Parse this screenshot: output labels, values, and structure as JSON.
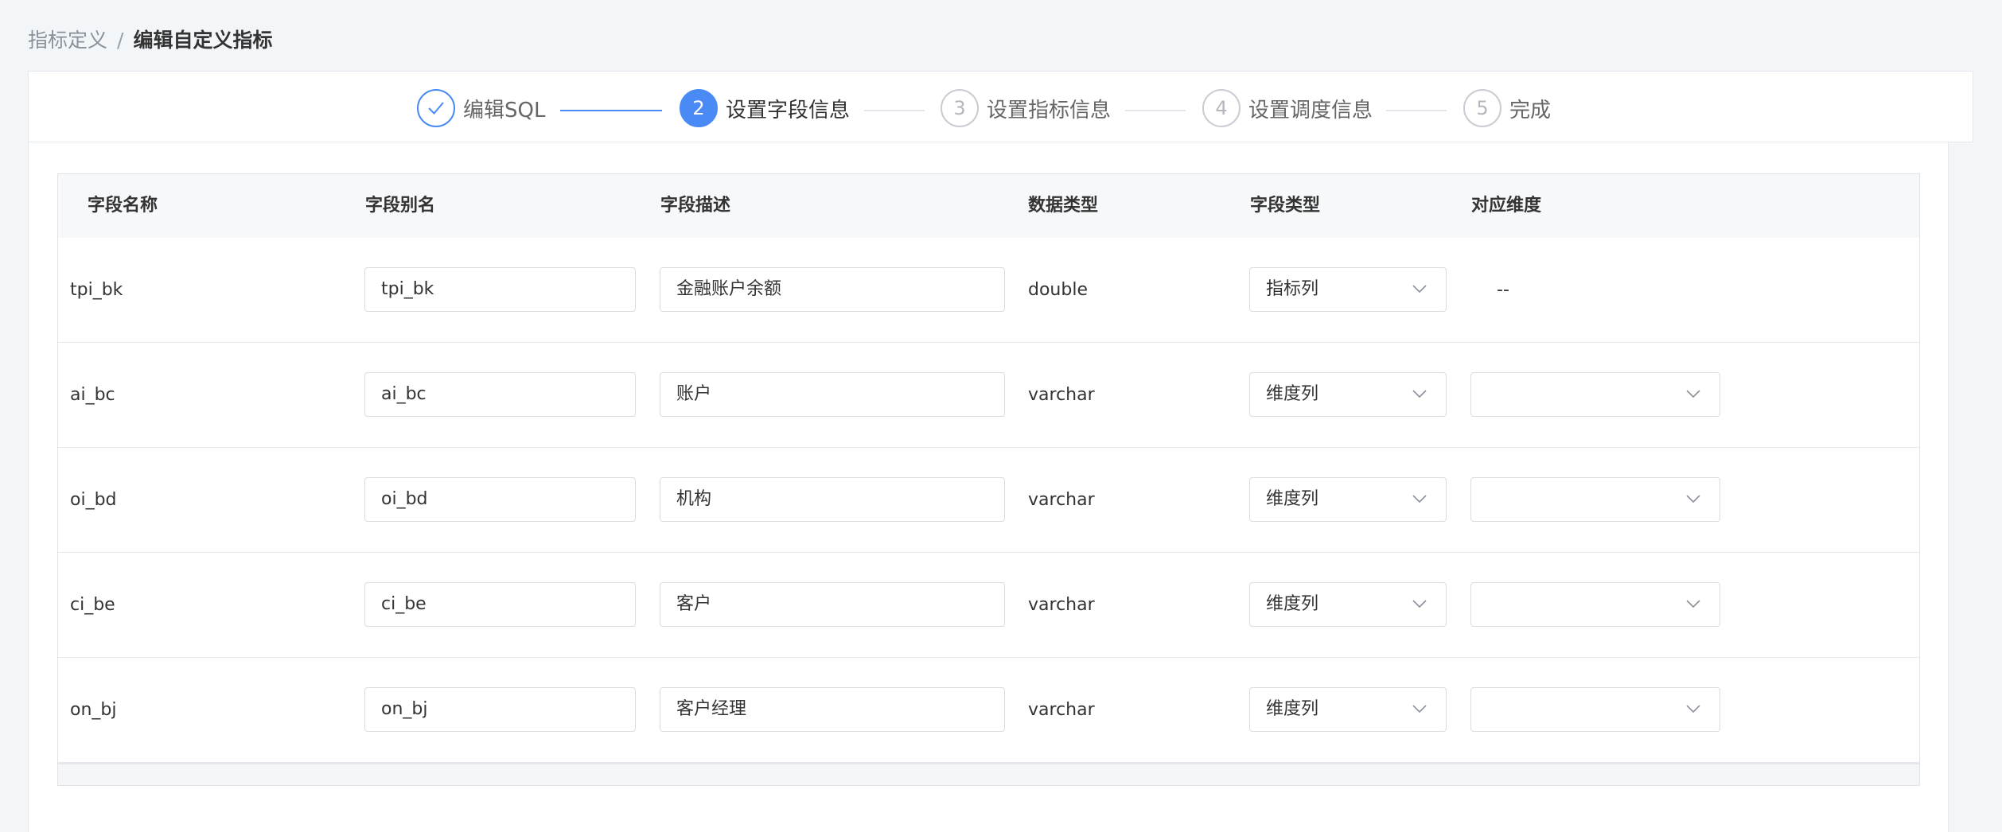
{
  "breadcrumb": {
    "parent": "指标定义",
    "separator": "/",
    "current": "编辑自定义指标"
  },
  "steps": [
    {
      "number": "✓",
      "label": "编辑SQL",
      "state": "done"
    },
    {
      "number": "2",
      "label": "设置字段信息",
      "state": "active"
    },
    {
      "number": "3",
      "label": "设置指标信息",
      "state": "pending"
    },
    {
      "number": "4",
      "label": "设置调度信息",
      "state": "pending"
    },
    {
      "number": "5",
      "label": "完成",
      "state": "pending"
    }
  ],
  "table": {
    "headers": [
      "字段名称",
      "字段别名",
      "字段描述",
      "数据类型",
      "字段类型",
      "对应维度"
    ],
    "rows": [
      {
        "name": "tpi_bk",
        "alias": "tpi_bk",
        "desc": "金融账户余额",
        "dtype": "double",
        "ftype": "指标列",
        "dim": "--"
      },
      {
        "name": "ai_bc",
        "alias": "ai_bc",
        "desc": "账户",
        "dtype": "varchar",
        "ftype": "维度列",
        "dim": ""
      },
      {
        "name": "oi_bd",
        "alias": "oi_bd",
        "desc": "机构",
        "dtype": "varchar",
        "ftype": "维度列",
        "dim": ""
      },
      {
        "name": "ci_be",
        "alias": "ci_be",
        "desc": "客户",
        "dtype": "varchar",
        "ftype": "维度列",
        "dim": ""
      },
      {
        "name": "on_bj",
        "alias": "on_bj",
        "desc": "客户经理",
        "dtype": "varchar",
        "ftype": "维度列",
        "dim": ""
      }
    ]
  },
  "colors": {
    "accent": "#4a8af4",
    "border": "#d9dce1",
    "header_bg": "#f7f8fa"
  },
  "icons": {
    "step_done": "check-icon",
    "select_arrow": "chevron-down-icon"
  }
}
